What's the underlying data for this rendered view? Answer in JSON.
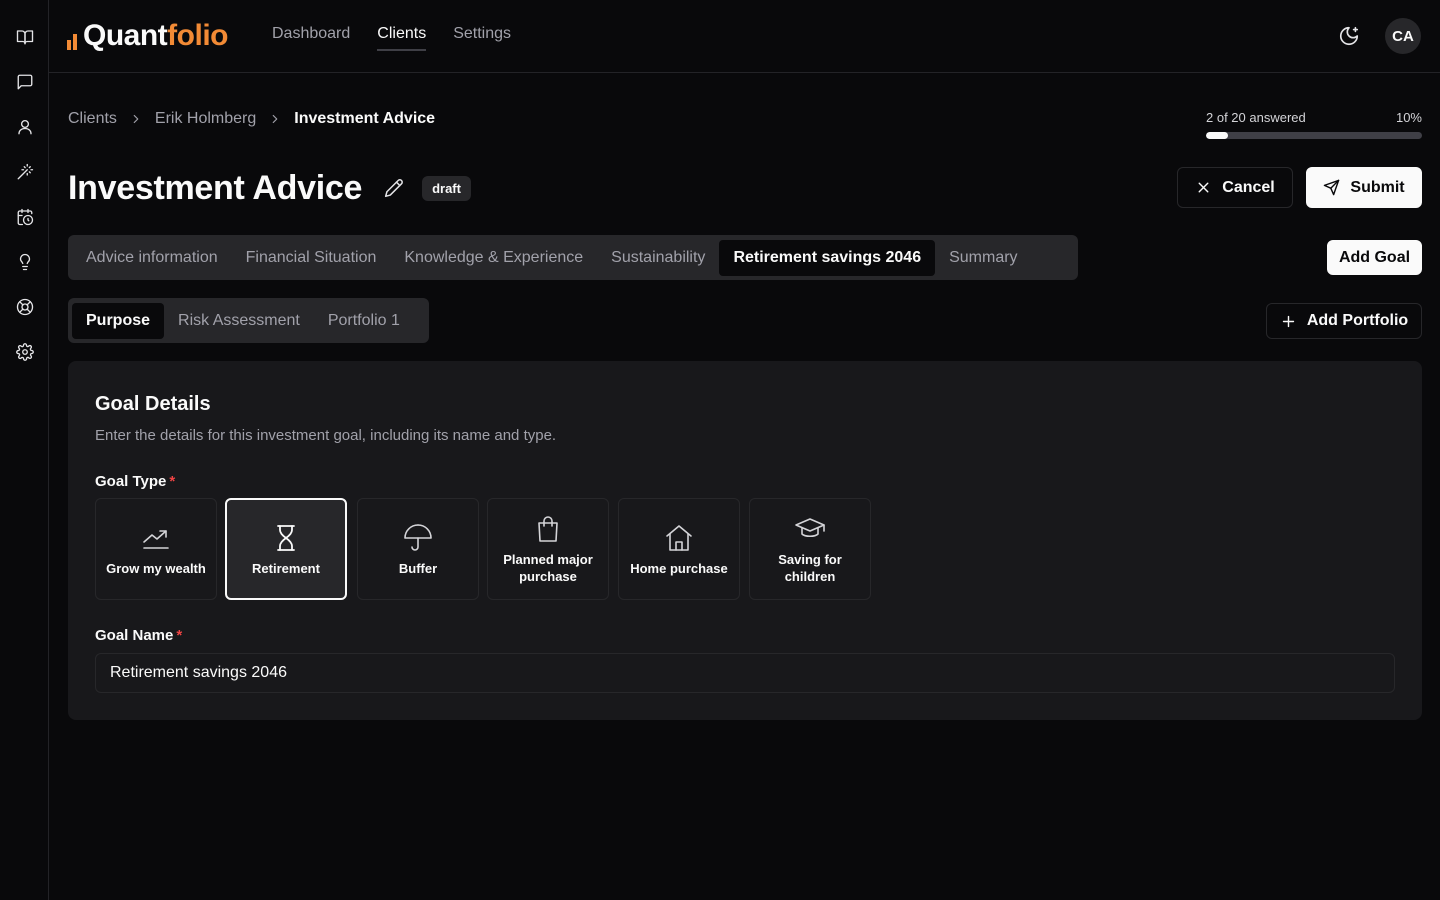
{
  "app": {
    "logo_q": "Q",
    "logo_uant": "uant",
    "logo_folio": "folio",
    "nav": [
      {
        "label": "Dashboard",
        "active": false
      },
      {
        "label": "Clients",
        "active": true
      },
      {
        "label": "Settings",
        "active": false
      }
    ],
    "user_initials": "CA",
    "rail_icons": [
      "book-open-icon",
      "message-square-icon",
      "user-icon",
      "magic-wand-icon",
      "calendar-clock-icon",
      "lightbulb-icon",
      "life-buoy-icon",
      "gear-icon"
    ]
  },
  "breadcrumb": [
    "Clients",
    "Erik Holmberg",
    "Investment Advice"
  ],
  "progress": {
    "answered_label": "2 of 20 answered",
    "percent_label": "10%",
    "fraction": 0.1
  },
  "page": {
    "title": "Investment Advice",
    "status_badge": "draft"
  },
  "actions": {
    "cancel": "Cancel",
    "submit": "Submit",
    "add_goal": "Add Goal",
    "add_portfolio": "Add Portfolio"
  },
  "tabs": [
    {
      "label": "Advice information",
      "active": false
    },
    {
      "label": "Financial Situation",
      "active": false
    },
    {
      "label": "Knowledge & Experience",
      "active": false
    },
    {
      "label": "Sustainability",
      "active": false
    },
    {
      "label": "Retirement savings 2046",
      "active": true
    },
    {
      "label": "Summary",
      "active": false
    }
  ],
  "subtabs": [
    {
      "label": "Purpose",
      "active": true
    },
    {
      "label": "Risk Assessment",
      "active": false
    },
    {
      "label": "Portfolio 1",
      "active": false
    }
  ],
  "goal_details": {
    "title": "Goal Details",
    "description": "Enter the details for this investment goal, including its name and type.",
    "goal_type_label": "Goal Type",
    "required_mark": "*",
    "goal_types": [
      {
        "label": "Grow my wealth",
        "icon": "trending-up-icon",
        "selected": false
      },
      {
        "label": "Retirement",
        "icon": "hourglass-icon",
        "selected": true
      },
      {
        "label": "Buffer",
        "icon": "umbrella-icon",
        "selected": false
      },
      {
        "label": "Planned major purchase",
        "icon": "shopping-bag-icon",
        "selected": false
      },
      {
        "label": "Home purchase",
        "icon": "house-icon",
        "selected": false
      },
      {
        "label": "Saving for children",
        "icon": "graduation-cap-icon",
        "selected": false
      }
    ],
    "goal_name_label": "Goal Name",
    "goal_name_value": "Retirement savings 2046"
  },
  "colors": {
    "background": "#09090b",
    "card": "#18181b",
    "muted": "#27272a",
    "accent": "#f28a35",
    "required": "#ef4444"
  }
}
